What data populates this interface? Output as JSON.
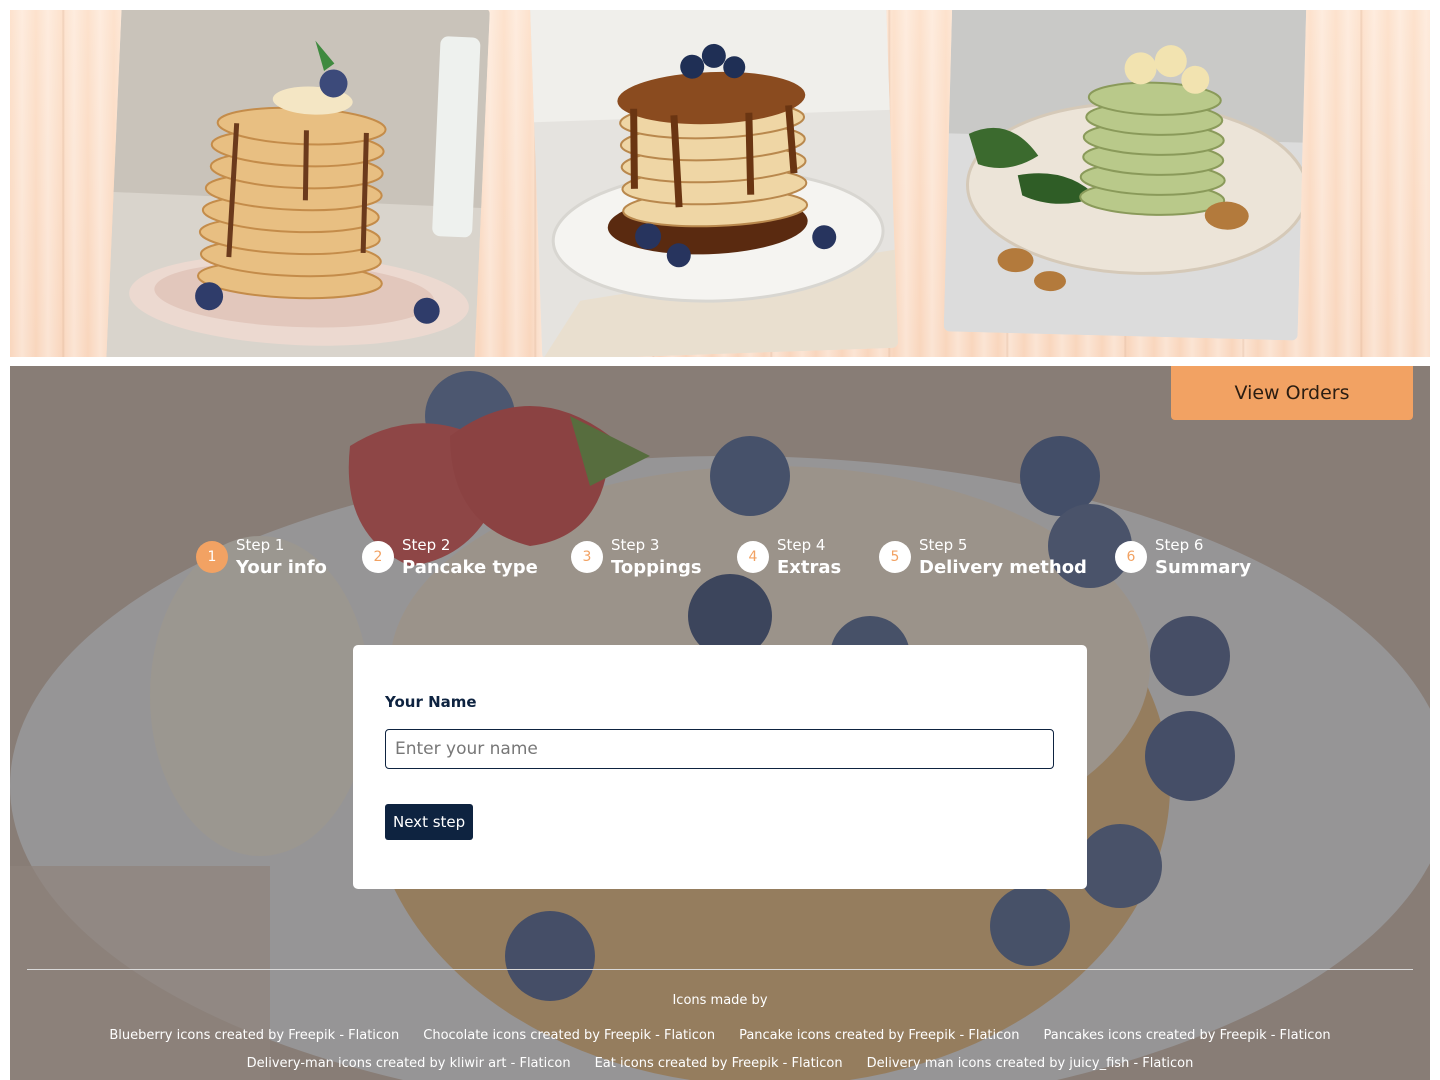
{
  "hero": {
    "photos": [
      {
        "name": "pancake-stack-banana-blueberry"
      },
      {
        "name": "pancake-stack-syrup-blueberry"
      },
      {
        "name": "pancake-stack-green-banana"
      }
    ]
  },
  "header": {
    "view_orders_label": "View Orders"
  },
  "steps": [
    {
      "number": "1",
      "label": "Step 1",
      "name": "Your info",
      "active": true
    },
    {
      "number": "2",
      "label": "Step 2",
      "name": "Pancake type",
      "active": false
    },
    {
      "number": "3",
      "label": "Step 3",
      "name": "Toppings",
      "active": false
    },
    {
      "number": "4",
      "label": "Step 4",
      "name": "Extras",
      "active": false
    },
    {
      "number": "5",
      "label": "Step 5",
      "name": "Delivery method",
      "active": false
    },
    {
      "number": "6",
      "label": "Step 6",
      "name": "Summary",
      "active": false
    }
  ],
  "form": {
    "name_label": "Your Name",
    "name_placeholder": "Enter your name",
    "name_value": "",
    "next_label": "Next step"
  },
  "footer": {
    "credits_title": "Icons made by",
    "credits_row_1": [
      "Blueberry icons created by Freepik - Flaticon",
      "Chocolate icons created by Freepik - Flaticon",
      "Pancake icons created by Freepik - Flaticon",
      "Pancakes icons created by Freepik - Flaticon"
    ],
    "credits_row_2": [
      "Delivery-man icons created by kliwir art - Flaticon",
      "Eat icons created by Freepik - Flaticon",
      "Delivery man icons created by juicy_fish - Flaticon"
    ]
  },
  "colors": {
    "accent": "#f2a263",
    "navy": "#0e2340",
    "wood": "#fde2cd"
  }
}
